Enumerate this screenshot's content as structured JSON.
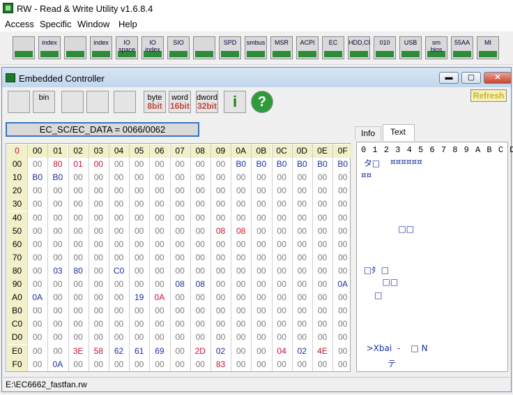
{
  "app": {
    "title": "RW - Read & Write Utility v1.6.8.4"
  },
  "menu": [
    "Access",
    "Specific",
    "Window",
    "Help"
  ],
  "toolbar": [
    {
      "name": "pci-icon",
      "label": ""
    },
    {
      "name": "pci-index-icon",
      "label": "index"
    },
    {
      "name": "memory-icon",
      "label": ""
    },
    {
      "name": "memory-index-icon",
      "label": "index"
    },
    {
      "name": "io-space-icon",
      "label": "IO space"
    },
    {
      "name": "io-index-icon",
      "label": "IO index"
    },
    {
      "name": "sio-icon",
      "label": "SIO"
    },
    {
      "name": "oscilloscope-icon",
      "label": ""
    },
    {
      "name": "spd-icon",
      "label": "SPD"
    },
    {
      "name": "smbus-icon",
      "label": "smbus"
    },
    {
      "name": "msr-icon",
      "label": "MSR"
    },
    {
      "name": "acpi-icon",
      "label": "ACPI"
    },
    {
      "name": "ec-icon",
      "label": "EC"
    },
    {
      "name": "hdd-cd-icon",
      "label": "HDD,CD"
    },
    {
      "name": "disk-icon",
      "label": "010"
    },
    {
      "name": "usb-icon",
      "label": "USB"
    },
    {
      "name": "smbios-icon",
      "label": "sm bios"
    },
    {
      "name": "aa55-icon",
      "label": "55AA"
    },
    {
      "name": "more-icon",
      "label": "MI"
    }
  ],
  "child": {
    "title": "Embedded Controller",
    "toolbar": [
      {
        "name": "save-icon",
        "lo": "",
        "hi": ""
      },
      {
        "name": "bin-icon",
        "lo": "bin",
        "hi": ""
      },
      {
        "name": "open-file-icon",
        "lo": "",
        "hi": ""
      },
      {
        "name": "find-icon",
        "lo": "",
        "hi": ""
      },
      {
        "name": "grid-icon",
        "lo": "",
        "hi": ""
      },
      {
        "name": "byte-8bit-button",
        "lo": "byte",
        "hi": "8bit"
      },
      {
        "name": "word-16bit-button",
        "lo": "word",
        "hi": "16bit"
      },
      {
        "name": "dword-32bit-button",
        "lo": "dword",
        "hi": "32bit"
      },
      {
        "name": "info-icon",
        "lo": "i",
        "hi": ""
      },
      {
        "name": "help-icon",
        "lo": "?",
        "hi": ""
      }
    ],
    "refresh_label": "Refresh",
    "ec_label": "EC_SC/EC_DATA = 0066/0062",
    "tabs": [
      "Info",
      "Text"
    ],
    "text_header": "0 1 2 3 4 5 6 7 8 9 A B C D E F",
    "hex_corner": "0",
    "col_headers": [
      "00",
      "01",
      "02",
      "03",
      "04",
      "05",
      "06",
      "07",
      "08",
      "09",
      "0A",
      "0B",
      "0C",
      "0D",
      "0E",
      "0F"
    ],
    "rows": [
      {
        "label": "00",
        "cells": [
          "00",
          "80",
          "01",
          "00",
          "00",
          "00",
          "00",
          "00",
          "00",
          "00",
          "B0",
          "B0",
          "B0",
          "B0",
          "B0",
          "B0"
        ],
        "colors": [
          "g",
          "r",
          "r",
          "r",
          "g",
          "g",
          "g",
          "g",
          "g",
          "g",
          "b",
          "b",
          "b",
          "b",
          "b",
          "b"
        ]
      },
      {
        "label": "10",
        "cells": [
          "B0",
          "B0",
          "00",
          "00",
          "00",
          "00",
          "00",
          "00",
          "00",
          "00",
          "00",
          "00",
          "00",
          "00",
          "00",
          "00"
        ],
        "colors": [
          "b",
          "b",
          "g",
          "g",
          "g",
          "g",
          "g",
          "g",
          "g",
          "g",
          "g",
          "g",
          "g",
          "g",
          "g",
          "g"
        ]
      },
      {
        "label": "20",
        "cells": [
          "00",
          "00",
          "00",
          "00",
          "00",
          "00",
          "00",
          "00",
          "00",
          "00",
          "00",
          "00",
          "00",
          "00",
          "00",
          "00"
        ],
        "colors": [
          "g",
          "g",
          "g",
          "g",
          "g",
          "g",
          "g",
          "g",
          "g",
          "g",
          "g",
          "g",
          "g",
          "g",
          "g",
          "g"
        ]
      },
      {
        "label": "30",
        "cells": [
          "00",
          "00",
          "00",
          "00",
          "00",
          "00",
          "00",
          "00",
          "00",
          "00",
          "00",
          "00",
          "00",
          "00",
          "00",
          "00"
        ],
        "colors": [
          "g",
          "g",
          "g",
          "g",
          "g",
          "g",
          "g",
          "g",
          "g",
          "g",
          "g",
          "g",
          "g",
          "g",
          "g",
          "g"
        ]
      },
      {
        "label": "40",
        "cells": [
          "00",
          "00",
          "00",
          "00",
          "00",
          "00",
          "00",
          "00",
          "00",
          "00",
          "00",
          "00",
          "00",
          "00",
          "00",
          "00"
        ],
        "colors": [
          "g",
          "g",
          "g",
          "g",
          "g",
          "g",
          "g",
          "g",
          "g",
          "g",
          "g",
          "g",
          "g",
          "g",
          "g",
          "g"
        ]
      },
      {
        "label": "50",
        "cells": [
          "00",
          "00",
          "00",
          "00",
          "00",
          "00",
          "00",
          "00",
          "00",
          "08",
          "08",
          "00",
          "00",
          "00",
          "00",
          "00"
        ],
        "colors": [
          "g",
          "g",
          "g",
          "g",
          "g",
          "g",
          "g",
          "g",
          "g",
          "r",
          "r",
          "g",
          "g",
          "g",
          "g",
          "g"
        ]
      },
      {
        "label": "60",
        "cells": [
          "00",
          "00",
          "00",
          "00",
          "00",
          "00",
          "00",
          "00",
          "00",
          "00",
          "00",
          "00",
          "00",
          "00",
          "00",
          "00"
        ],
        "colors": [
          "g",
          "g",
          "g",
          "g",
          "g",
          "g",
          "g",
          "g",
          "g",
          "g",
          "g",
          "g",
          "g",
          "g",
          "g",
          "g"
        ]
      },
      {
        "label": "70",
        "cells": [
          "00",
          "00",
          "00",
          "00",
          "00",
          "00",
          "00",
          "00",
          "00",
          "00",
          "00",
          "00",
          "00",
          "00",
          "00",
          "00"
        ],
        "colors": [
          "g",
          "g",
          "g",
          "g",
          "g",
          "g",
          "g",
          "g",
          "g",
          "g",
          "g",
          "g",
          "g",
          "g",
          "g",
          "g"
        ]
      },
      {
        "label": "80",
        "cells": [
          "00",
          "03",
          "80",
          "00",
          "C0",
          "00",
          "00",
          "00",
          "00",
          "00",
          "00",
          "00",
          "00",
          "00",
          "00",
          "00"
        ],
        "colors": [
          "g",
          "b",
          "b",
          "g",
          "b",
          "g",
          "g",
          "g",
          "g",
          "g",
          "g",
          "g",
          "g",
          "g",
          "g",
          "g"
        ]
      },
      {
        "label": "90",
        "cells": [
          "00",
          "00",
          "00",
          "00",
          "00",
          "00",
          "00",
          "08",
          "08",
          "00",
          "00",
          "00",
          "00",
          "00",
          "00",
          "0A"
        ],
        "colors": [
          "g",
          "g",
          "g",
          "g",
          "g",
          "g",
          "g",
          "b",
          "b",
          "g",
          "g",
          "g",
          "g",
          "g",
          "g",
          "b"
        ]
      },
      {
        "label": "A0",
        "cells": [
          "0A",
          "00",
          "00",
          "00",
          "00",
          "19",
          "0A",
          "00",
          "00",
          "00",
          "00",
          "00",
          "00",
          "00",
          "00",
          "00"
        ],
        "colors": [
          "b",
          "g",
          "g",
          "g",
          "g",
          "b",
          "r",
          "g",
          "g",
          "g",
          "g",
          "g",
          "g",
          "g",
          "g",
          "g"
        ]
      },
      {
        "label": "B0",
        "cells": [
          "00",
          "00",
          "00",
          "00",
          "00",
          "00",
          "00",
          "00",
          "00",
          "00",
          "00",
          "00",
          "00",
          "00",
          "00",
          "00"
        ],
        "colors": [
          "g",
          "g",
          "g",
          "g",
          "g",
          "g",
          "g",
          "g",
          "g",
          "g",
          "g",
          "g",
          "g",
          "g",
          "g",
          "g"
        ]
      },
      {
        "label": "C0",
        "cells": [
          "00",
          "00",
          "00",
          "00",
          "00",
          "00",
          "00",
          "00",
          "00",
          "00",
          "00",
          "00",
          "00",
          "00",
          "00",
          "00"
        ],
        "colors": [
          "g",
          "g",
          "g",
          "g",
          "g",
          "g",
          "g",
          "g",
          "g",
          "g",
          "g",
          "g",
          "g",
          "g",
          "g",
          "g"
        ]
      },
      {
        "label": "D0",
        "cells": [
          "00",
          "00",
          "00",
          "00",
          "00",
          "00",
          "00",
          "00",
          "00",
          "00",
          "00",
          "00",
          "00",
          "00",
          "00",
          "00"
        ],
        "colors": [
          "g",
          "g",
          "g",
          "g",
          "g",
          "g",
          "g",
          "g",
          "g",
          "g",
          "g",
          "g",
          "g",
          "g",
          "g",
          "g"
        ]
      },
      {
        "label": "E0",
        "cells": [
          "00",
          "00",
          "3E",
          "58",
          "62",
          "61",
          "69",
          "00",
          "2D",
          "02",
          "00",
          "00",
          "04",
          "02",
          "4E",
          "00"
        ],
        "colors": [
          "g",
          "g",
          "r",
          "r",
          "b",
          "b",
          "b",
          "g",
          "r",
          "b",
          "g",
          "g",
          "r",
          "b",
          "r",
          "g"
        ]
      },
      {
        "label": "F0",
        "cells": [
          "00",
          "0A",
          "00",
          "00",
          "00",
          "00",
          "00",
          "00",
          "00",
          "83",
          "00",
          "00",
          "00",
          "00",
          "00",
          "00"
        ],
        "colors": [
          "g",
          "b",
          "g",
          "g",
          "g",
          "g",
          "g",
          "g",
          "g",
          "r",
          "g",
          "g",
          "g",
          "g",
          "g",
          "g"
        ]
      }
    ],
    "text_rows": [
      {
        "row": 0,
        "text": " タ□"
      },
      {
        "row": 0,
        "text": "           ¤¤¤¤¤¤",
        "offset": true
      },
      {
        "row": 1,
        "text": "¤¤"
      },
      {
        "row": 5,
        "text": "              □□"
      },
      {
        "row": 8,
        "text": " □ﾀ  □"
      },
      {
        "row": 9,
        "text": "        □□"
      },
      {
        "row": 10,
        "text": "     □"
      },
      {
        "row": 14,
        "text": "  >Xbai  -    □ N"
      },
      {
        "row": 15,
        "text": "          テ"
      }
    ]
  },
  "status": {
    "path": "E:\\EC6662_fastfan.rw"
  }
}
